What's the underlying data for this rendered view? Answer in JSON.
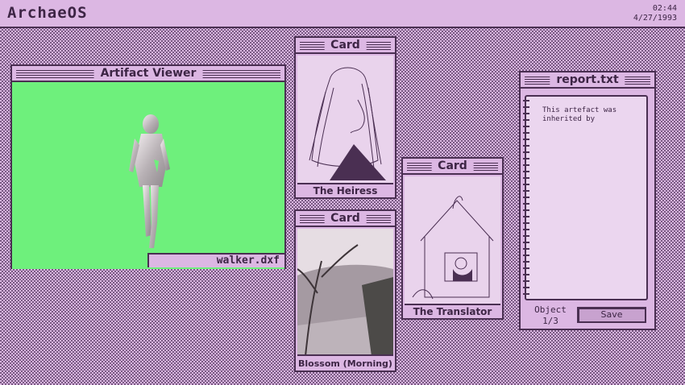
{
  "menubar": {
    "title": "ArchaeOS",
    "time": "02:44",
    "date": "4/27/1993"
  },
  "viewer": {
    "title": "Artifact Viewer",
    "filename": "walker.dxf",
    "canvas_color": "#6ef07c"
  },
  "cards": [
    {
      "title": "Card",
      "caption": "The Heiress"
    },
    {
      "title": "Card",
      "caption": "Blossom (Morning)"
    },
    {
      "title": "Card",
      "caption": "The Translator"
    }
  ],
  "report": {
    "title": "report.txt",
    "text": "This artefact was\ninherited by",
    "counter_label": "Object",
    "counter_value": "1/3",
    "save_label": "Save"
  },
  "colors": {
    "ink": "#4a2f52",
    "paper": "#dcb7e3",
    "accent": "#6ef07c"
  }
}
